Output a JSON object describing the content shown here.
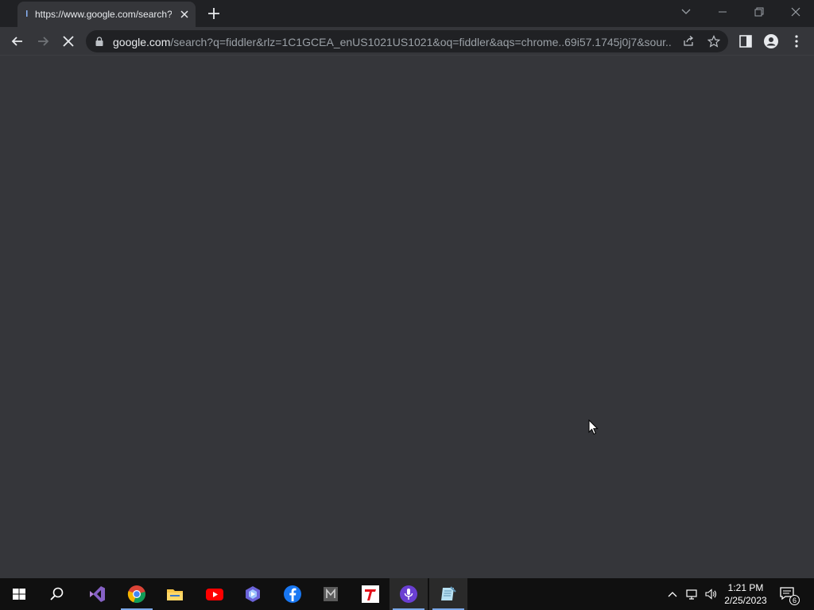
{
  "browser": {
    "tab": {
      "title": "https://www.google.com/search?q=fiddler",
      "loading": true
    },
    "address": {
      "host": "google.com",
      "path": "/search?q=fiddler&rlz=1C1GCEA_enUS1021US1021&oq=fiddler&aqs=chrome..69i57.1745j0j7&sour..."
    }
  },
  "taskbar": {
    "apps": [
      "start-icon",
      "search-icon",
      "visual-studio-icon",
      "chrome-icon",
      "file-explorer-icon",
      "youtube-icon",
      "copilot-icon",
      "facebook-icon",
      "m-app-icon",
      "t-app-icon",
      "podcast-icon",
      "notepad-icon"
    ],
    "clock": {
      "time": "1:21 PM",
      "date": "2/25/2023"
    },
    "notifications": "6"
  },
  "colors": {
    "tabstrip": "#202124",
    "toolbar": "#35363a",
    "taskbar": "#101010",
    "accent": "#7aa7e8"
  }
}
